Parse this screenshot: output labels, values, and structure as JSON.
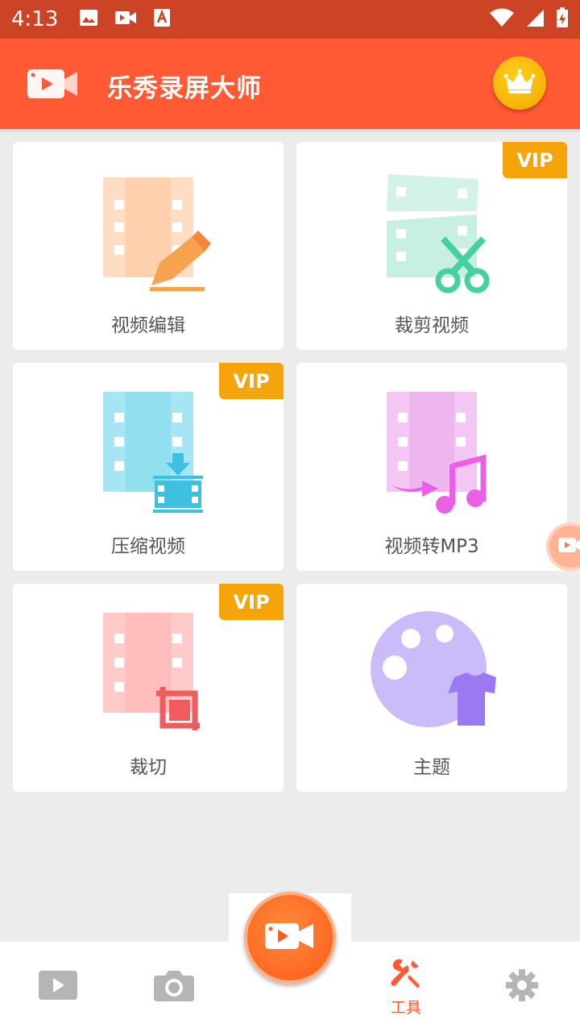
{
  "status_bar": {
    "time": "4:13"
  },
  "app_bar": {
    "title": "乐秀录屏大师"
  },
  "tools": [
    {
      "label": "视频编辑",
      "vip": false
    },
    {
      "label": "裁剪视频",
      "vip": true
    },
    {
      "label": "压缩视频",
      "vip": true
    },
    {
      "label": "视频转MP3",
      "vip": false
    },
    {
      "label": "裁切",
      "vip": true
    },
    {
      "label": "主题",
      "vip": false
    }
  ],
  "vip_label": "VIP",
  "bottom_nav": {
    "tools_label": "工具"
  },
  "colors": {
    "brand": "#ff5a33",
    "status_bar": "#cc4326",
    "vip": "#f5a50a"
  }
}
